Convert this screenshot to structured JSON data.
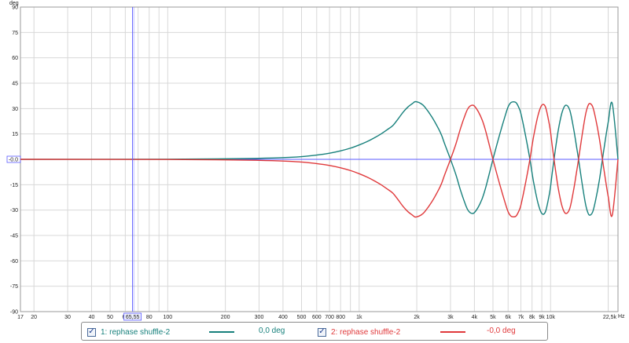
{
  "chart_data": {
    "type": "line",
    "x_unit": "Hz",
    "y_unit": "deg",
    "x_scale": "log",
    "xlim": [
      17,
      22500
    ],
    "ylim": [
      -90,
      90
    ],
    "grid": true,
    "y_ticks": [
      "90",
      "75",
      "60",
      "45",
      "30",
      "15",
      "-0.0",
      "-15",
      "-30",
      "-45",
      "-60",
      "-75",
      "-90"
    ],
    "y_tick_values": [
      90,
      75,
      60,
      45,
      30,
      15,
      0,
      -15,
      -30,
      -45,
      -60,
      -75,
      -90
    ],
    "x_ticks": [
      {
        "label": "17",
        "value": 17
      },
      {
        "label": "20",
        "value": 20
      },
      {
        "label": "30",
        "value": 30
      },
      {
        "label": "40",
        "value": 40
      },
      {
        "label": "50",
        "value": 50
      },
      {
        "label": "60",
        "value": 60
      },
      {
        "label": "80",
        "value": 80
      },
      {
        "label": "100",
        "value": 100
      },
      {
        "label": "200",
        "value": 200
      },
      {
        "label": "300",
        "value": 300
      },
      {
        "label": "400",
        "value": 400
      },
      {
        "label": "500",
        "value": 500
      },
      {
        "label": "600",
        "value": 600
      },
      {
        "label": "700",
        "value": 700
      },
      {
        "label": "800",
        "value": 800
      },
      {
        "label": "1k",
        "value": 1000
      },
      {
        "label": "2k",
        "value": 2000
      },
      {
        "label": "3k",
        "value": 3000
      },
      {
        "label": "4k",
        "value": 4000
      },
      {
        "label": "5k",
        "value": 5000
      },
      {
        "label": "6k",
        "value": 6000
      },
      {
        "label": "7k",
        "value": 7000
      },
      {
        "label": "8k",
        "value": 8000
      },
      {
        "label": "9k",
        "value": 9000
      },
      {
        "label": "10k",
        "value": 10000
      },
      {
        "label": "22,5k",
        "value": 22500
      }
    ],
    "cursor": {
      "x": 65.5,
      "label": "65,55",
      "y_label": "-0.0"
    },
    "series": [
      {
        "name": "1: rephase shuffle-2",
        "color": "#17807c",
        "value_label": "0,0 deg",
        "x": [
          17,
          100,
          200,
          300,
          400,
          500,
          600,
          700,
          800,
          900,
          1000,
          1100,
          1200,
          1300,
          1400,
          1500,
          1600,
          1700,
          1800,
          1900,
          1950,
          2000,
          2100,
          2200,
          2400,
          2600,
          2700,
          2800,
          3000,
          3200,
          3400,
          3600,
          3700,
          3800,
          3900,
          4000,
          4200,
          4400,
          4600,
          5000,
          5400,
          5800,
          6000,
          6200,
          6400,
          6600,
          6800,
          7000,
          7400,
          7800,
          8000,
          8200,
          8600,
          9000,
          9400,
          9800,
          10000,
          10200,
          10600,
          11000,
          11500,
          12000,
          12600,
          13200,
          13600,
          14000,
          14600,
          15200,
          15600,
          16000,
          16600,
          17200,
          18000,
          19000,
          20000,
          21000,
          22500
        ],
        "y": [
          0,
          0.1,
          0.3,
          0.6,
          1,
          1.6,
          2.5,
          3.6,
          5,
          6.6,
          8.5,
          10.5,
          12.7,
          15,
          17.5,
          20,
          24,
          28,
          31,
          33,
          34,
          34,
          33,
          31,
          25,
          18,
          14,
          9,
          0,
          -9,
          -19,
          -27,
          -30,
          -31.5,
          -32,
          -31.5,
          -28,
          -23,
          -16,
          0,
          14,
          26,
          31,
          33.5,
          34,
          33.5,
          31,
          27,
          14,
          0,
          -8,
          -15,
          -26,
          -32,
          -31,
          -22,
          -16,
          -8,
          6,
          18,
          28,
          32,
          29,
          18,
          9,
          0,
          -14,
          -26,
          -31,
          -33,
          -31,
          -24,
          -12,
          6,
          22,
          33,
          0
        ]
      },
      {
        "name": "2: rephase shuffle-2",
        "color": "#e0393b",
        "value_label": "-0,0 deg",
        "x": [
          17,
          100,
          200,
          300,
          400,
          500,
          600,
          700,
          800,
          900,
          1000,
          1100,
          1200,
          1300,
          1400,
          1500,
          1600,
          1700,
          1800,
          1900,
          1950,
          2000,
          2100,
          2200,
          2400,
          2600,
          2700,
          2800,
          3000,
          3200,
          3400,
          3600,
          3700,
          3800,
          3900,
          4000,
          4200,
          4400,
          4600,
          5000,
          5400,
          5800,
          6000,
          6200,
          6400,
          6600,
          6800,
          7000,
          7400,
          7800,
          8000,
          8200,
          8600,
          9000,
          9400,
          9800,
          10000,
          10200,
          10600,
          11000,
          11500,
          12000,
          12600,
          13200,
          13600,
          14000,
          14600,
          15200,
          15600,
          16000,
          16600,
          17200,
          18000,
          19000,
          20000,
          21000,
          22500
        ],
        "y": [
          0,
          -0.1,
          -0.3,
          -0.6,
          -1,
          -1.6,
          -2.5,
          -3.6,
          -5,
          -6.6,
          -8.5,
          -10.5,
          -12.7,
          -15,
          -17.5,
          -20,
          -24,
          -28,
          -31,
          -33,
          -34,
          -34,
          -33,
          -31,
          -25,
          -18,
          -14,
          -9,
          0,
          9,
          19,
          27,
          30,
          31.5,
          32,
          31.5,
          28,
          23,
          16,
          0,
          -14,
          -26,
          -31,
          -33.5,
          -34,
          -33.5,
          -31,
          -27,
          -14,
          0,
          8,
          15,
          26,
          32,
          31,
          22,
          16,
          8,
          -6,
          -18,
          -28,
          -32,
          -29,
          -18,
          -9,
          0,
          14,
          26,
          31,
          33,
          31,
          24,
          12,
          -6,
          -22,
          -33,
          0
        ]
      }
    ]
  },
  "legend": {
    "items": [
      {
        "checkbox": "✓",
        "name": "1: rephase shuffle-2",
        "color": "#17807c",
        "value": "0,0 deg"
      },
      {
        "checkbox": "✓",
        "name": "2: rephase shuffle-2",
        "color": "#e0393b",
        "value": "-0,0 deg"
      }
    ]
  },
  "colors": {
    "grid": "#d8d8d8",
    "axis": "#9a9a9a",
    "cursor": "#5b5bff",
    "zero_line": "#5b5bff"
  }
}
